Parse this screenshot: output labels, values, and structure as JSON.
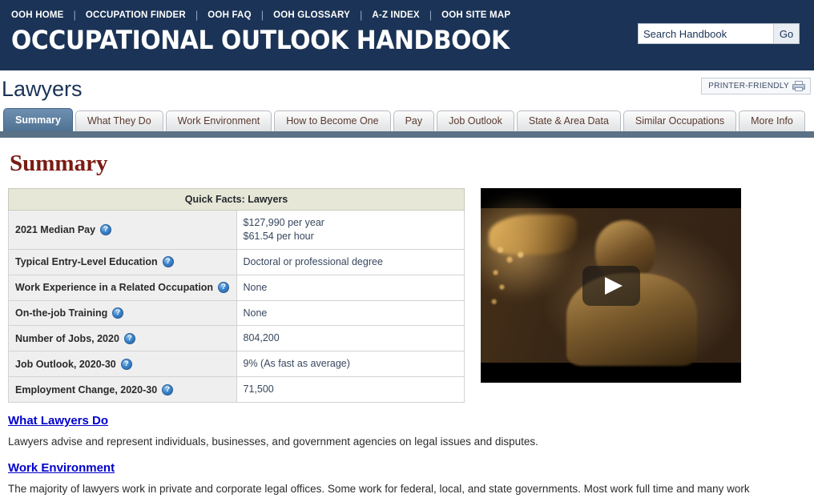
{
  "header": {
    "site_title": "OCCUPATIONAL OUTLOOK HANDBOOK",
    "nav": [
      {
        "label": "OOH HOME"
      },
      {
        "label": "OCCUPATION FINDER"
      },
      {
        "label": "OOH FAQ"
      },
      {
        "label": "OOH GLOSSARY"
      },
      {
        "label": "A-Z INDEX"
      },
      {
        "label": "OOH SITE MAP"
      }
    ],
    "search": {
      "value": "Search Handbook",
      "placeholder": "Search Handbook",
      "button_label": "Go"
    },
    "background_color": "#1b3356"
  },
  "page": {
    "title": "Lawyers",
    "printer_friendly_label": "PRINTER-FRIENDLY",
    "printer_icon": "printer-icon"
  },
  "tabs": [
    {
      "label": "Summary",
      "active": true
    },
    {
      "label": "What They Do",
      "active": false
    },
    {
      "label": "Work Environment",
      "active": false
    },
    {
      "label": "How to Become One",
      "active": false
    },
    {
      "label": "Pay",
      "active": false
    },
    {
      "label": "Job Outlook",
      "active": false
    },
    {
      "label": "State & Area Data",
      "active": false
    },
    {
      "label": "Similar Occupations",
      "active": false
    },
    {
      "label": "More Info",
      "active": false
    }
  ],
  "main": {
    "heading": "Summary",
    "quick_facts": {
      "caption": "Quick Facts: Lawyers",
      "help_icon": "question-mark-icon",
      "rows": [
        {
          "label": "2021 Median Pay",
          "value": "$127,990 per year\n$61.54 per hour",
          "value_lines": [
            "$127,990 per year",
            "$61.54 per hour"
          ]
        },
        {
          "label": "Typical Entry-Level Education",
          "value": "Doctoral or professional degree",
          "value_lines": [
            "Doctoral or professional degree"
          ]
        },
        {
          "label": "Work Experience in a Related Occupation",
          "value": "None",
          "value_lines": [
            "None"
          ]
        },
        {
          "label": "On-the-job Training",
          "value": "None",
          "value_lines": [
            "None"
          ]
        },
        {
          "label": "Number of Jobs, 2020",
          "value": "804,200",
          "value_lines": [
            "804,200"
          ]
        },
        {
          "label": "Job Outlook, 2020-30",
          "value": "9% (As fast as average)",
          "value_lines": [
            "9% (As fast as average)"
          ]
        },
        {
          "label": "Employment Change, 2020-30",
          "value": "71,500",
          "value_lines": [
            "71,500"
          ]
        }
      ]
    },
    "video": {
      "name": "lawyers-career-video",
      "play_icon": "play-triangle-icon"
    },
    "sections": [
      {
        "link": "What Lawyers Do",
        "body": "Lawyers advise and represent individuals, businesses, and government agencies on legal issues and disputes."
      },
      {
        "link": "Work Environment",
        "body": "The majority of lawyers work in private and corporate legal offices. Some work for federal, local, and state governments. Most work full time and many work"
      }
    ]
  }
}
